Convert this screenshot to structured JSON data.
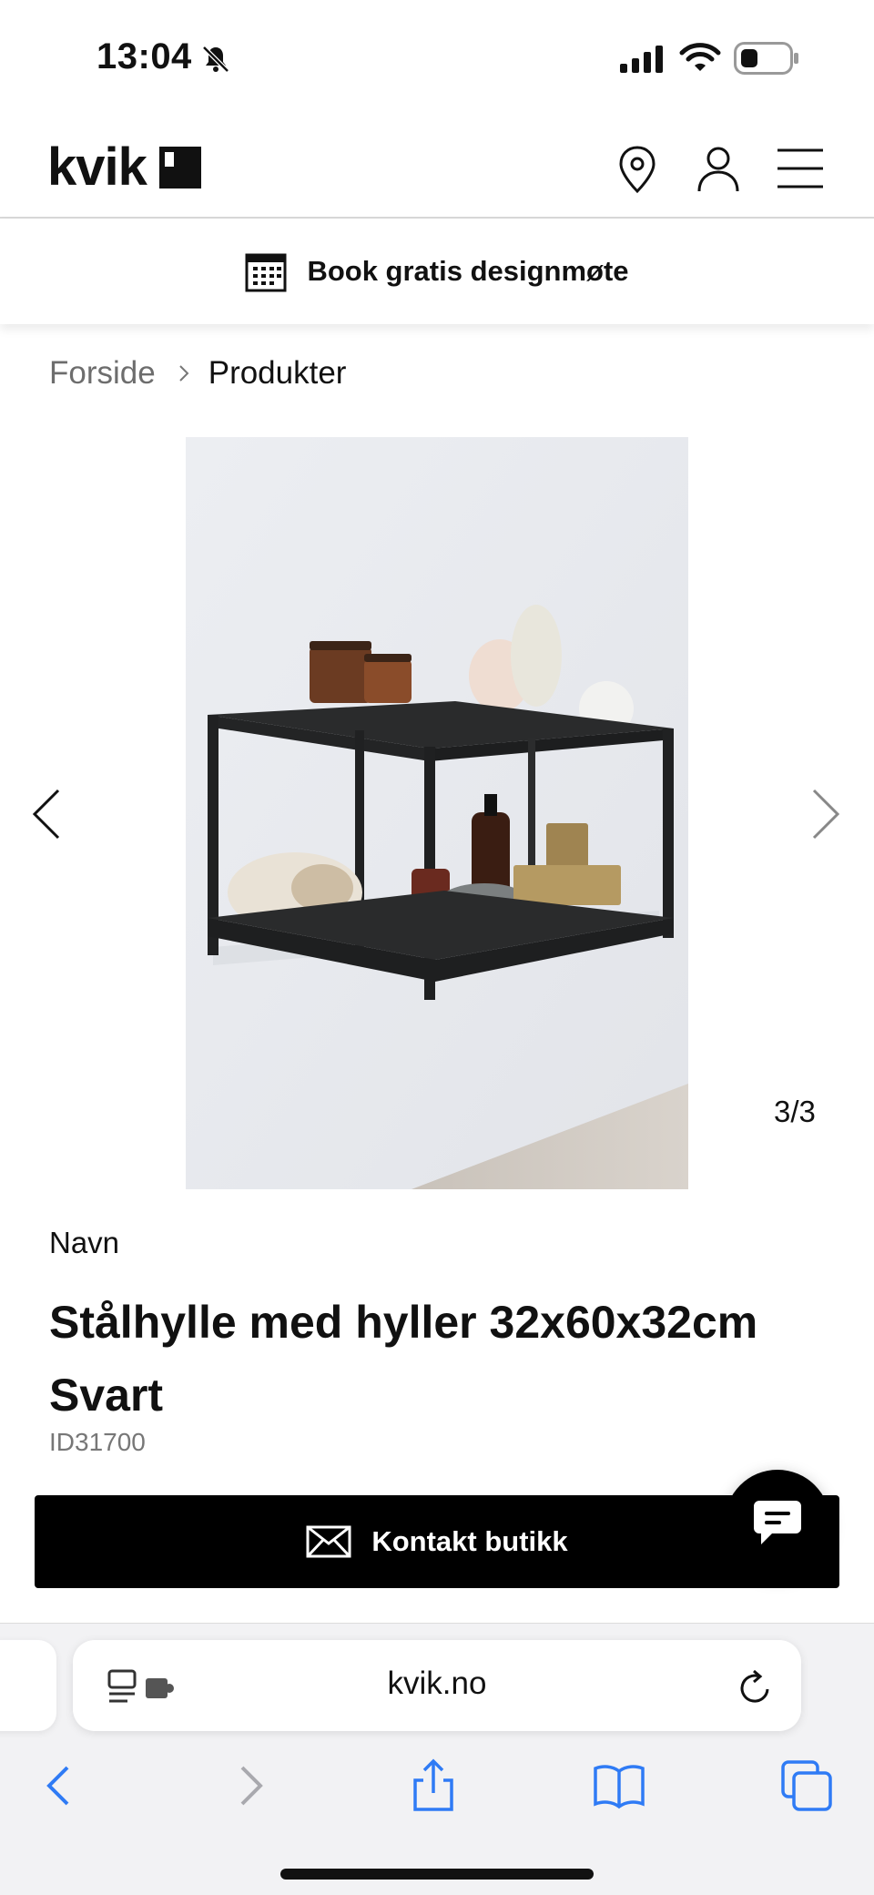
{
  "status_bar": {
    "time": "13:04",
    "icons": [
      "bell-slash-icon",
      "cellular-signal-icon",
      "wifi-icon",
      "battery-icon"
    ]
  },
  "header": {
    "logo": "kvik",
    "icons": [
      "location-pin-icon",
      "user-icon",
      "hamburger-menu-icon"
    ]
  },
  "banner": {
    "icon": "calendar-icon",
    "label": "Book gratis designmøte"
  },
  "breadcrumb": {
    "items": [
      "Forside",
      "Produkter"
    ]
  },
  "gallery": {
    "counter": "3/3",
    "prev_icon": "chevron-left-icon",
    "next_icon": "chevron-right-icon"
  },
  "product": {
    "name_label": "Navn",
    "title": "Stålhylle med hyller 32x60x32cm Svart",
    "id": "ID31700"
  },
  "actions": {
    "contact_label": "Kontakt butikk",
    "contact_icon": "mail-icon",
    "chat_icon": "chat-bubble-icon"
  },
  "browser": {
    "url": "kvik.no",
    "toolbar_icons": [
      "back-icon",
      "forward-icon",
      "share-icon",
      "bookmarks-icon",
      "tabs-icon"
    ]
  },
  "colors": {
    "button_bg": "#000000",
    "browser_accent": "#2f7bf5",
    "muted_text": "#6d6d6d"
  }
}
